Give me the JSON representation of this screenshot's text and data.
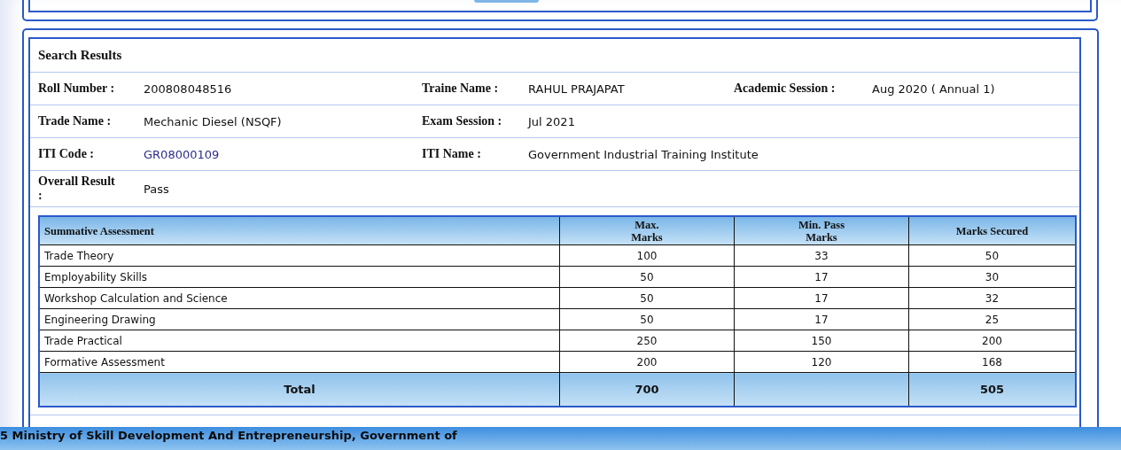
{
  "results": {
    "title": "Search Results",
    "rows": [
      [
        {
          "label": "Roll Number :",
          "value": "200808048516"
        },
        {
          "label": "Traine Name :",
          "value": "RAHUL PRAJAPAT"
        },
        {
          "label": "Academic Session :",
          "value": "Aug 2020 ( Annual 1)"
        }
      ],
      [
        {
          "label": "Trade Name :",
          "value": "Mechanic Diesel (NSQF)"
        },
        {
          "label": "Exam Session :",
          "value": "Jul 2021"
        }
      ],
      [
        {
          "label": "ITI Code :",
          "value": "GR08000109",
          "kind": "link"
        },
        {
          "label": "ITI Name :",
          "value": "Government Industrial Training Institute"
        }
      ],
      [
        {
          "label": "Overall Result :",
          "value": "Pass"
        }
      ]
    ]
  },
  "table": {
    "columns": [
      "Summative Assessment",
      "Max. Marks",
      "Min. Pass Marks",
      "Marks Secured"
    ],
    "rows": [
      [
        "Trade Theory",
        "100",
        "33",
        "50"
      ],
      [
        "Employability Skills",
        "50",
        "17",
        "30"
      ],
      [
        "Workshop Calculation and Science",
        "50",
        "17",
        "32"
      ],
      [
        "Engineering Drawing",
        "50",
        "17",
        "25"
      ],
      [
        "Trade Practical",
        "250",
        "150",
        "200"
      ],
      [
        "Formative Assessment",
        "200",
        "120",
        "168"
      ]
    ],
    "total": {
      "label": "Total",
      "max": "700",
      "secured": "505"
    }
  },
  "footer": "5 Ministry of Skill Development And Entrepreneurship, Government of"
}
